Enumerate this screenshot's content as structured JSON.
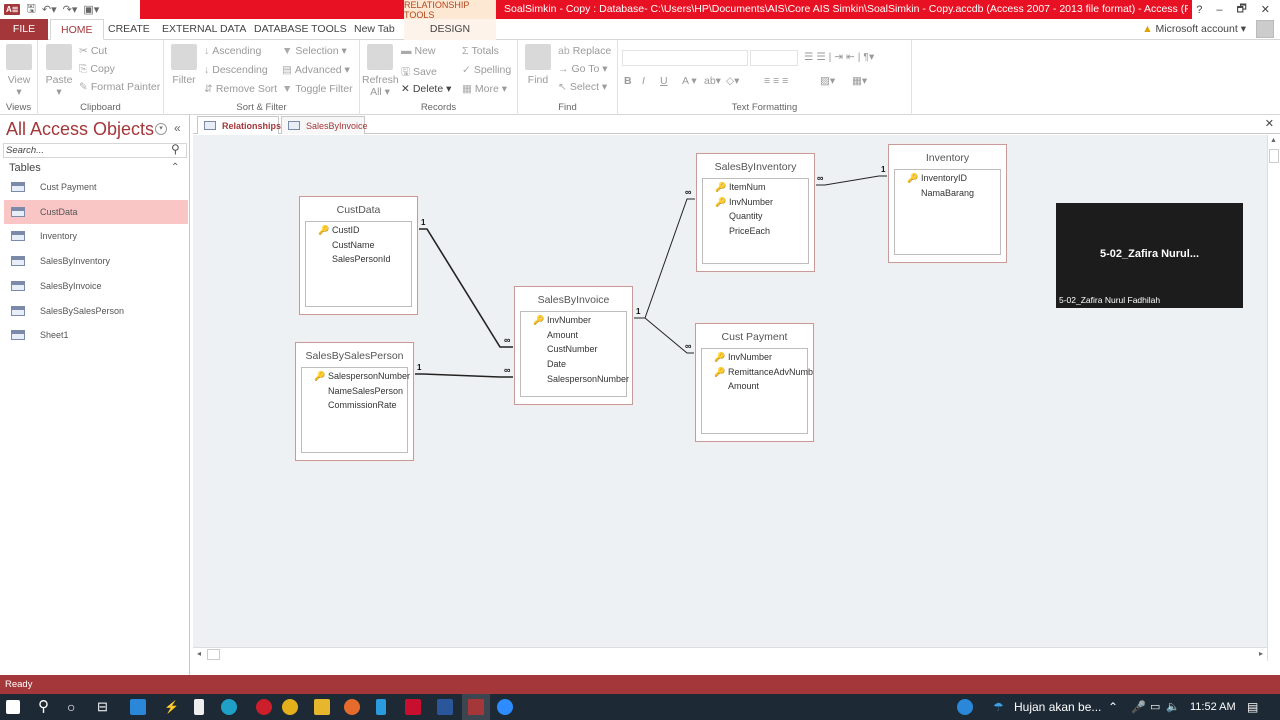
{
  "window": {
    "title": "SoalSimkin - Copy : Database- C:\\Users\\HP\\Documents\\AIS\\Core AIS Simkin\\SoalSimkin - Copy.accdb (Access 2007 - 2013 file format) -  Access (Product...",
    "context_tab_group": "RELATIONSHIP TOOLS",
    "controls": {
      "help": "?",
      "minimize": "–",
      "restore": "🗗",
      "close": "✕"
    },
    "account": "Microsoft account"
  },
  "ribbon_tabs": [
    "FILE",
    "HOME",
    "CREATE",
    "EXTERNAL DATA",
    "DATABASE TOOLS",
    "New Tab",
    "DESIGN"
  ],
  "ribbon": {
    "views": {
      "label": "Views",
      "view": "View"
    },
    "clipboard": {
      "label": "Clipboard",
      "paste": "Paste",
      "cut": "Cut",
      "copy": "Copy",
      "format_painter": "Format Painter"
    },
    "sort_filter": {
      "label": "Sort & Filter",
      "filter": "Filter",
      "ascending": "Ascending",
      "descending": "Descending",
      "remove_sort": "Remove Sort",
      "selection": "Selection",
      "advanced": "Advanced",
      "toggle_filter": "Toggle Filter"
    },
    "records": {
      "label": "Records",
      "refresh": "Refresh",
      "refresh2": "All",
      "new": "New",
      "save": "Save",
      "delete": "Delete",
      "totals": "Totals",
      "spelling": "Spelling",
      "more": "More"
    },
    "find": {
      "label": "Find",
      "find": "Find",
      "replace": "Replace",
      "goto": "Go To",
      "select": "Select"
    },
    "text_formatting": {
      "label": "Text Formatting",
      "bold": "B",
      "italic": "I",
      "underline": "U",
      "font_color": "A"
    }
  },
  "nav": {
    "title": "All Access Objects",
    "search_placeholder": "Search...",
    "section": "Tables",
    "items": [
      {
        "label": "Cust Payment",
        "selected": false
      },
      {
        "label": "CustData",
        "selected": true
      },
      {
        "label": "Inventory",
        "selected": false
      },
      {
        "label": "SalesByInventory",
        "selected": false
      },
      {
        "label": "SalesByInvoice",
        "selected": false
      },
      {
        "label": "SalesBySalesPerson",
        "selected": false
      },
      {
        "label": "Sheet1",
        "selected": false
      }
    ]
  },
  "doc_tabs": [
    {
      "label": "Relationships",
      "active": true
    },
    {
      "label": "SalesByInvoice",
      "active": false
    }
  ],
  "tables": {
    "custdata": {
      "title": "CustData",
      "fields": [
        {
          "name": "CustID",
          "key": true
        },
        {
          "name": "CustName",
          "key": false
        },
        {
          "name": "SalesPersonId",
          "key": false
        }
      ]
    },
    "salesbysalesperson": {
      "title": "SalesBySalesPerson",
      "fields": [
        {
          "name": "SalespersonNumber",
          "key": true
        },
        {
          "name": "NameSalesPerson",
          "key": false
        },
        {
          "name": "CommissionRate",
          "key": false
        }
      ]
    },
    "salesbyinvoice": {
      "title": "SalesByInvoice",
      "fields": [
        {
          "name": "InvNumber",
          "key": true
        },
        {
          "name": "Amount",
          "key": false
        },
        {
          "name": "CustNumber",
          "key": false
        },
        {
          "name": "Date",
          "key": false
        },
        {
          "name": "SalespersonNumber",
          "key": false
        }
      ]
    },
    "salesbyinventory": {
      "title": "SalesByInventory",
      "fields": [
        {
          "name": "ItemNum",
          "key": true
        },
        {
          "name": "InvNumber",
          "key": true
        },
        {
          "name": "Quantity",
          "key": false
        },
        {
          "name": "PriceEach",
          "key": false
        }
      ]
    },
    "inventory": {
      "title": "Inventory",
      "fields": [
        {
          "name": "InventoryID",
          "key": true
        },
        {
          "name": "NamaBarang",
          "key": false
        }
      ]
    },
    "custpayment": {
      "title": "Cust Payment",
      "fields": [
        {
          "name": "InvNumber",
          "key": true
        },
        {
          "name": "RemittanceAdvNumb",
          "key": true
        },
        {
          "name": "Amount",
          "key": false
        }
      ]
    }
  },
  "relationships": [
    {
      "from": "CustData.CustID",
      "to": "SalesByInvoice.CustNumber",
      "one": "1",
      "many": "∞"
    },
    {
      "from": "SalesBySalesPerson.SalespersonNumber",
      "to": "SalesByInvoice.SalespersonNumber",
      "one": "1",
      "many": "∞"
    },
    {
      "from": "SalesByInvoice.InvNumber",
      "to": "SalesByInventory.InvNumber",
      "one": "1",
      "many": "∞"
    },
    {
      "from": "SalesByInvoice.InvNumber",
      "to": "Cust Payment.InvNumber",
      "one": "1",
      "many": "∞"
    },
    {
      "from": "Inventory.InventoryID",
      "to": "SalesByInventory.ItemNum",
      "one": "1",
      "many": "∞"
    }
  ],
  "video_overlay": {
    "main": "5-02_Zafira  Nurul...",
    "name": "5-02_Zafira Nurul Fadhilah"
  },
  "status": "Ready",
  "taskbar": {
    "weather": "Hujan akan be...",
    "time": "11:52 AM"
  }
}
